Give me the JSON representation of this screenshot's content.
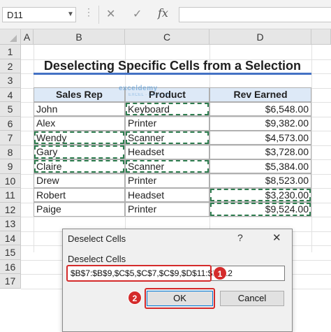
{
  "formula_bar": {
    "name_box": "D11",
    "cancel_icon": "✕",
    "enter_icon": "✓",
    "fx_label": "fx",
    "formula": ""
  },
  "columns": [
    "A",
    "B",
    "C",
    "D"
  ],
  "rows": [
    "1",
    "2",
    "3",
    "4",
    "5",
    "6",
    "7",
    "8",
    "9",
    "10",
    "11",
    "12",
    "13",
    "14",
    "15",
    "16",
    "17"
  ],
  "sheet": {
    "title": "Deselecting Specific Cells from a Selection",
    "headers": [
      "Sales Rep",
      "Product",
      "Rev Earned"
    ],
    "data": [
      [
        "John",
        "Keyboard",
        "$6,548.00"
      ],
      [
        "Alex",
        "Printer",
        "$9,382.00"
      ],
      [
        "Wendy",
        "Scanner",
        "$4,573.00"
      ],
      [
        "Gary",
        "Headset",
        "$3,728.00"
      ],
      [
        "Claire",
        "Scanner",
        "$5,384.00"
      ],
      [
        "Drew",
        "Printer",
        "$8,523.00"
      ],
      [
        "Robert",
        "Headset",
        "$3,230.00"
      ],
      [
        "Paige",
        "Printer",
        "$9,524.00"
      ]
    ]
  },
  "dialog": {
    "title": "Deselect Cells",
    "help": "?",
    "close": "✕",
    "field_label": "Deselect Cells",
    "field_value": "$B$7:$B$9,$C$5,$C$7,$C$9,$D$11:$D$12",
    "ok_label": "OK",
    "cancel_label": "Cancel"
  },
  "annotations": {
    "step1": "1",
    "step2": "2",
    "accent": "#d42b2b"
  },
  "watermark": {
    "name": "exceldemy",
    "tagline": "EXCEL · DATA · BI"
  }
}
